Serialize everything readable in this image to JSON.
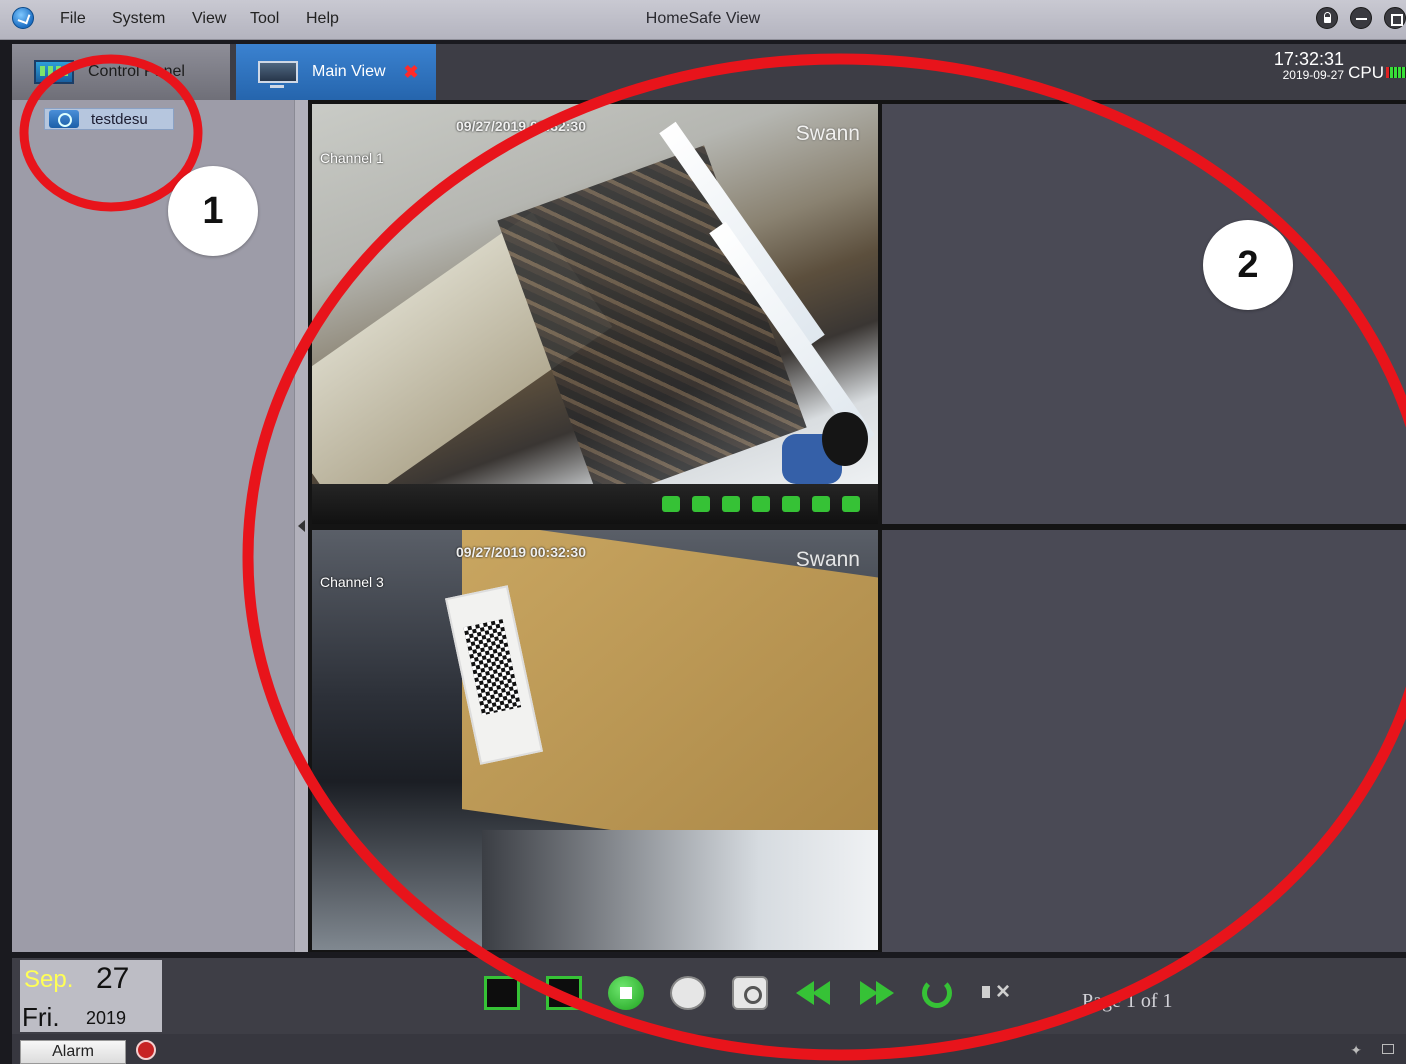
{
  "titlebar": {
    "app_title": "HomeSafe View",
    "menu": [
      "File",
      "System",
      "View",
      "Tool",
      "Help"
    ]
  },
  "tabs": {
    "control_panel": "Control Panel",
    "main_view": "Main View",
    "close_glyph": "✖"
  },
  "status": {
    "time": "17:32:31",
    "date": "2019-09-27",
    "cpu_label": "CPU"
  },
  "sidebar": {
    "device": "testdesu"
  },
  "channels": [
    {
      "label": "Channel 1",
      "timestamp": "09/27/2019  00:32:30",
      "brand": "Swann"
    },
    {
      "label": "Channel 3",
      "timestamp": "09/27/2019  00:32:30",
      "brand": "Swann"
    }
  ],
  "datebox": {
    "month": "Sep.",
    "day": "27",
    "weekday": "Fri.",
    "year": "2019"
  },
  "playback": {
    "page_label": "Page 1 of 1"
  },
  "statusbar": {
    "alarm_label": "Alarm",
    "pin_glyph": "✦"
  },
  "annotations": {
    "badge1": "1",
    "badge2": "2",
    "highlight_color": "#e8141b"
  },
  "colors": {
    "accent_green": "#36c236",
    "tab_active": "#2565ad"
  }
}
